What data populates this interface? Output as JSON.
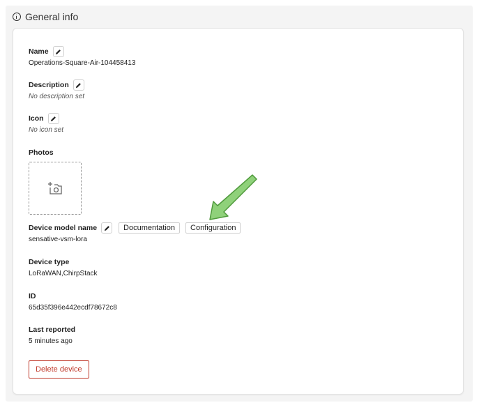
{
  "header": {
    "title": "General info"
  },
  "fields": {
    "name": {
      "label": "Name",
      "value": "Operations-Square-Air-104458413"
    },
    "description": {
      "label": "Description",
      "value": "No description set"
    },
    "icon": {
      "label": "Icon",
      "value": "No icon set"
    },
    "photos": {
      "label": "Photos"
    },
    "device_model": {
      "label": "Device model name",
      "value": "sensative-vsm-lora",
      "documentation_label": "Documentation",
      "configuration_label": "Configuration"
    },
    "device_type": {
      "label": "Device type",
      "value": "LoRaWAN,ChirpStack"
    },
    "id": {
      "label": "ID",
      "value": "65d35f396e442ecdf78672c8"
    },
    "last_reported": {
      "label": "Last reported",
      "value": "5 minutes ago"
    }
  },
  "actions": {
    "delete_label": "Delete device"
  },
  "colors": {
    "accent_danger": "#c0392b",
    "arrow_fill": "#8fd17a",
    "arrow_stroke": "#4f9a3c"
  }
}
